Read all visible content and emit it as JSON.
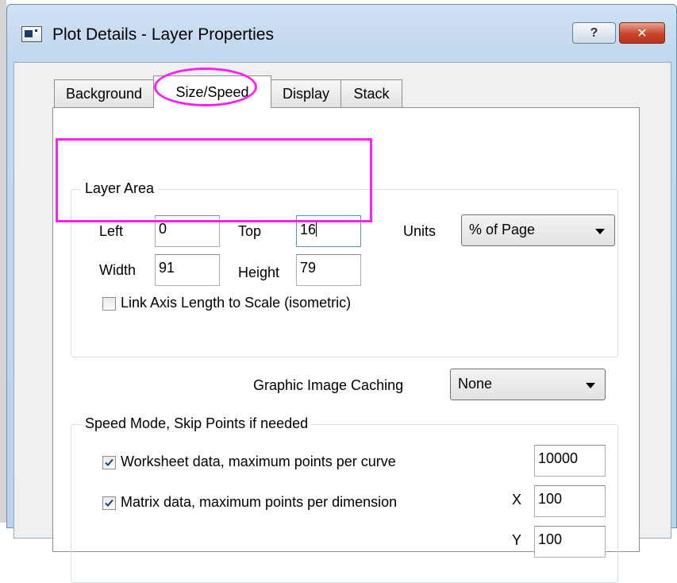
{
  "window": {
    "title": "Plot Details - Layer Properties",
    "help_label": "?",
    "close_label": "✕"
  },
  "tabs": [
    {
      "label": "Background",
      "active": false
    },
    {
      "label": "Size/Speed",
      "active": true
    },
    {
      "label": "Display",
      "active": false
    },
    {
      "label": "Stack",
      "active": false
    }
  ],
  "layer_area": {
    "legend": "Layer Area",
    "left_label": "Left",
    "left_value": "0",
    "top_label": "Top",
    "top_value": "16",
    "width_label": "Width",
    "width_value": "91",
    "height_label": "Height",
    "height_value": "79",
    "units_label": "Units",
    "units_value": "% of Page",
    "link_axis_label": "Link Axis Length to Scale (isometric)",
    "link_axis_checked": false
  },
  "caching": {
    "label": "Graphic Image Caching",
    "value": "None"
  },
  "speed_mode": {
    "legend": "Speed Mode, Skip Points if needed",
    "worksheet_label": "Worksheet data, maximum points per curve",
    "worksheet_checked": true,
    "worksheet_value": "10000",
    "matrix_label": "Matrix data, maximum points per dimension",
    "matrix_checked": true,
    "x_label": "X",
    "x_value": "100",
    "y_label": "Y",
    "y_value": "100"
  },
  "annotation_color": "#ff1ff0"
}
